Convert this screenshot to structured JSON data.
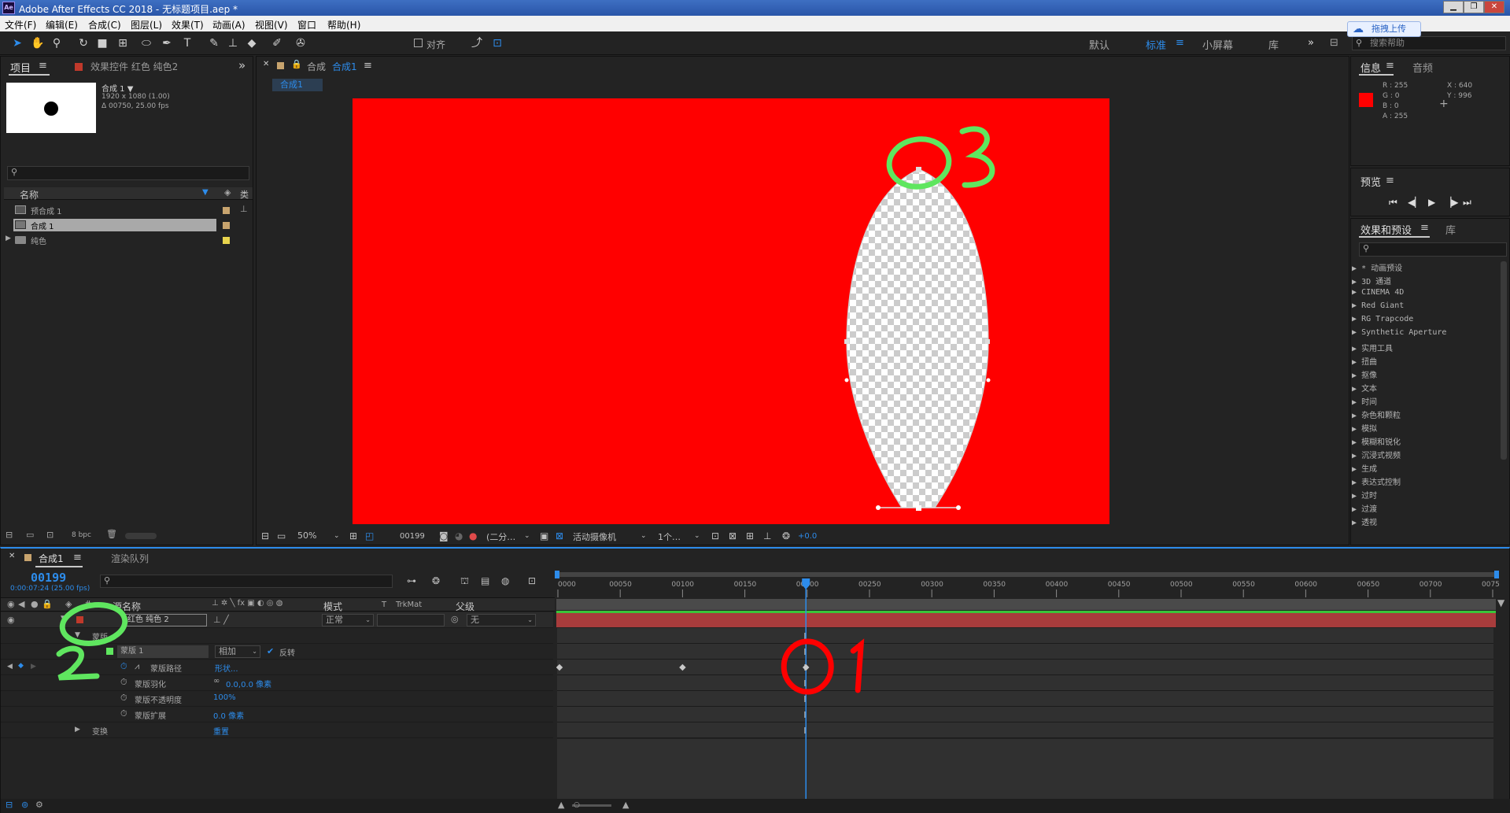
{
  "titlebar": {
    "app_icon": "Ae",
    "title": "Adobe After Effects CC 2018 - 无标题项目.aep *",
    "upload_badge": "拖拽上传"
  },
  "menu": [
    "文件(F)",
    "编辑(E)",
    "合成(C)",
    "图层(L)",
    "效果(T)",
    "动画(A)",
    "视图(V)",
    "窗口",
    "帮助(H)"
  ],
  "toolbar": {
    "align_label": "对齐",
    "workspaces": [
      "默认",
      "标准",
      "小屏幕",
      "库"
    ],
    "search_placeholder": "搜索帮助"
  },
  "project_panel": {
    "tab_project": "项目",
    "tab_effects": "效果控件 红色 纯色2",
    "comp_name": "合成 1 ▼",
    "comp_res": "1920 x 1080 (1.00)",
    "comp_dur": "Δ 00750, 25.00 fps",
    "col_name": "名称",
    "col_type": "类",
    "items": [
      {
        "name": "预合成 1",
        "color": "#c8a46e"
      },
      {
        "name": "合成 1",
        "color": "#c8a46e"
      },
      {
        "name": "纯色",
        "color": "#e8d44d"
      }
    ],
    "bpc": "8 bpc"
  },
  "comp_panel": {
    "tab_label": "合成",
    "tab_active": "合成1",
    "sub_tab": "合成1",
    "zoom": "50%",
    "frame": "00199",
    "resolution": "(二分…",
    "camera": "活动摄像机",
    "views": "1个…",
    "exposure": "+0.0"
  },
  "info_panel": {
    "tab_info": "信息",
    "tab_audio": "音频",
    "r": "R : 255",
    "g": "G : 0",
    "b": "B : 0",
    "a": "A : 255",
    "x": "X : 640",
    "y": "Y : 996",
    "swatch": "#ff0000"
  },
  "preview_panel": {
    "title": "预览"
  },
  "effects_panel": {
    "tab": "效果和预设",
    "tab_lib": "库",
    "items": [
      "* 动画预设",
      "3D 通道",
      "CINEMA 4D",
      "Red Giant",
      "RG Trapcode",
      "Synthetic Aperture",
      "实用工具",
      "扭曲",
      "抠像",
      "文本",
      "时间",
      "杂色和颗粒",
      "模拟",
      "模糊和锐化",
      "沉浸式视频",
      "生成",
      "表达式控制",
      "过时",
      "过渡",
      "透视"
    ]
  },
  "timeline": {
    "tab_comp": "合成1",
    "tab_render": "渲染队列",
    "timecode": "00199",
    "timecode_sub": "0:00:07:24 (25.00 fps)",
    "col_source": "源名称",
    "col_mode": "模式",
    "col_t": "T",
    "col_trkmat": "TrkMat",
    "col_parent": "父级",
    "layer_name": "红色 纯色 2",
    "layer_mode": "正常",
    "layer_parent": "无",
    "mask_group": "蒙版",
    "mask_name": "蒙版 1",
    "mask_mode": "相加",
    "mask_invert": "反转",
    "props": [
      {
        "name": "蒙版路径",
        "value": "形状..."
      },
      {
        "name": "蒙版羽化",
        "value": "0.0,0.0 像素"
      },
      {
        "name": "蒙版不透明度",
        "value": "100%"
      },
      {
        "name": "蒙版扩展",
        "value": "0.0 像素"
      }
    ],
    "transform": "变换",
    "transform_value": "重置",
    "ticks": [
      "0000",
      "00050",
      "00100",
      "00150",
      "00200",
      "00250",
      "00300",
      "00350",
      "00400",
      "00450",
      "00500",
      "00550",
      "00600",
      "00650",
      "00700",
      "0075"
    ],
    "playhead_frame": 199,
    "keyframe_frames": [
      0,
      100
    ]
  },
  "annotations": {
    "one": "1",
    "two": "2",
    "three": "3"
  },
  "colors": {
    "accent": "#2d8ceb",
    "comp_bg": "#ff0000",
    "layer_bar": "#a83c3c",
    "annot_red": "#ff0000",
    "annot_green": "#5fe65f"
  }
}
